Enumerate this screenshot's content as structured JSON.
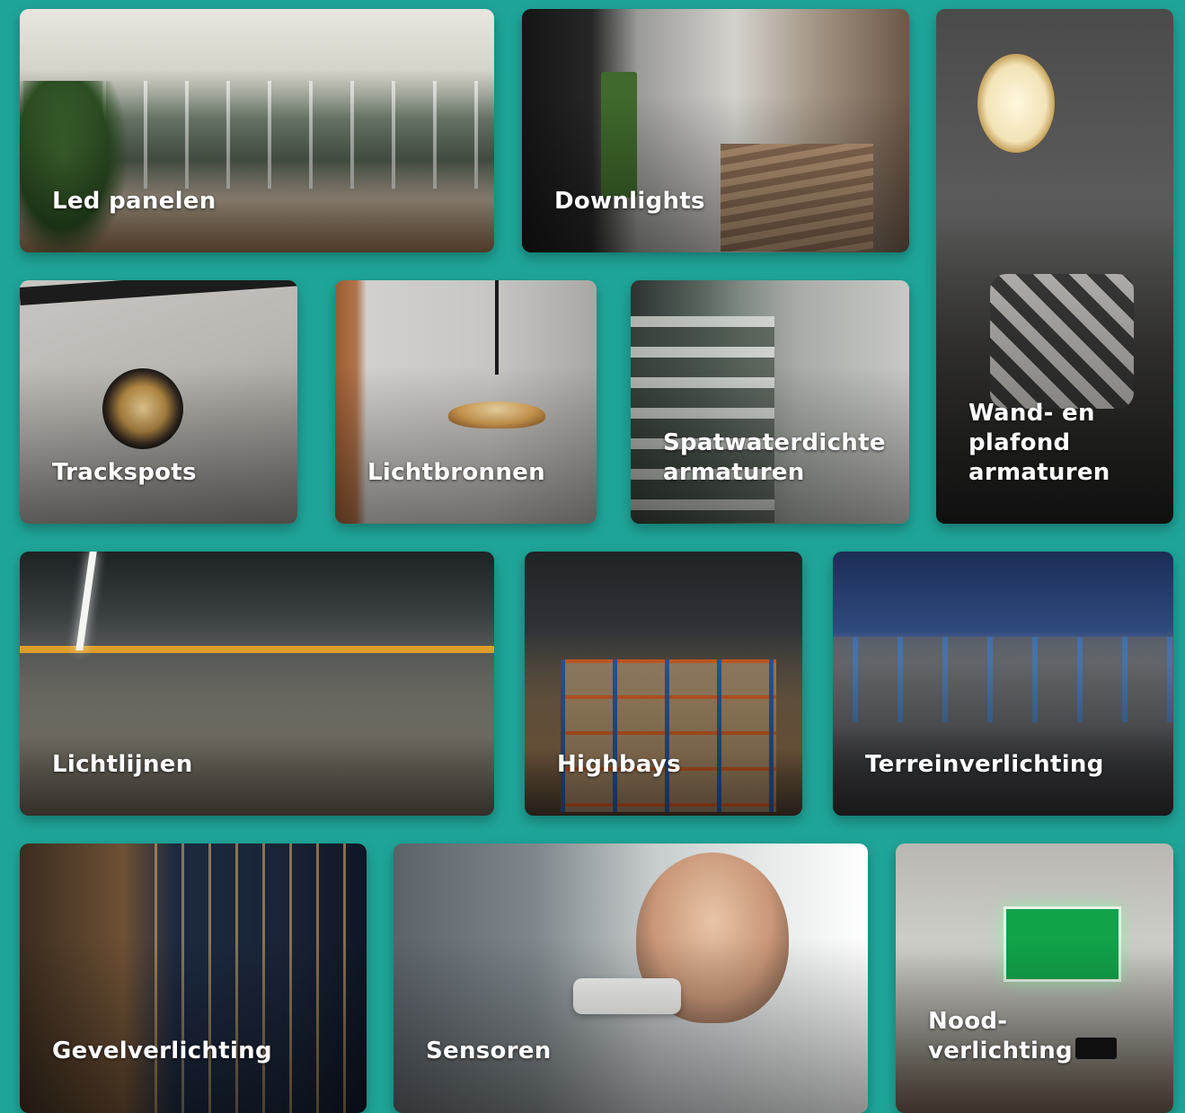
{
  "tiles": {
    "led_panelen": {
      "label": "Led panelen"
    },
    "downlights": {
      "label": "Downlights"
    },
    "wand_plafond": {
      "label": "Wand- en\nplafond\narmaturen"
    },
    "trackspots": {
      "label": "Trackspots"
    },
    "lichtbronnen": {
      "label": "Lichtbronnen"
    },
    "spatwaterdicht": {
      "label": "Spatwaterdichte\narmaturen"
    },
    "lichtlijnen": {
      "label": "Lichtlijnen"
    },
    "highbays": {
      "label": "Highbays"
    },
    "terreinverlichting": {
      "label": "Terreinverlichting"
    },
    "gevelverlichting": {
      "label": "Gevelverlichting"
    },
    "sensoren": {
      "label": "Sensoren"
    },
    "noodverlichting": {
      "label": "Nood-\nverlichting"
    }
  },
  "colors": {
    "background": "#1fa598",
    "label_text": "#ffffff"
  }
}
